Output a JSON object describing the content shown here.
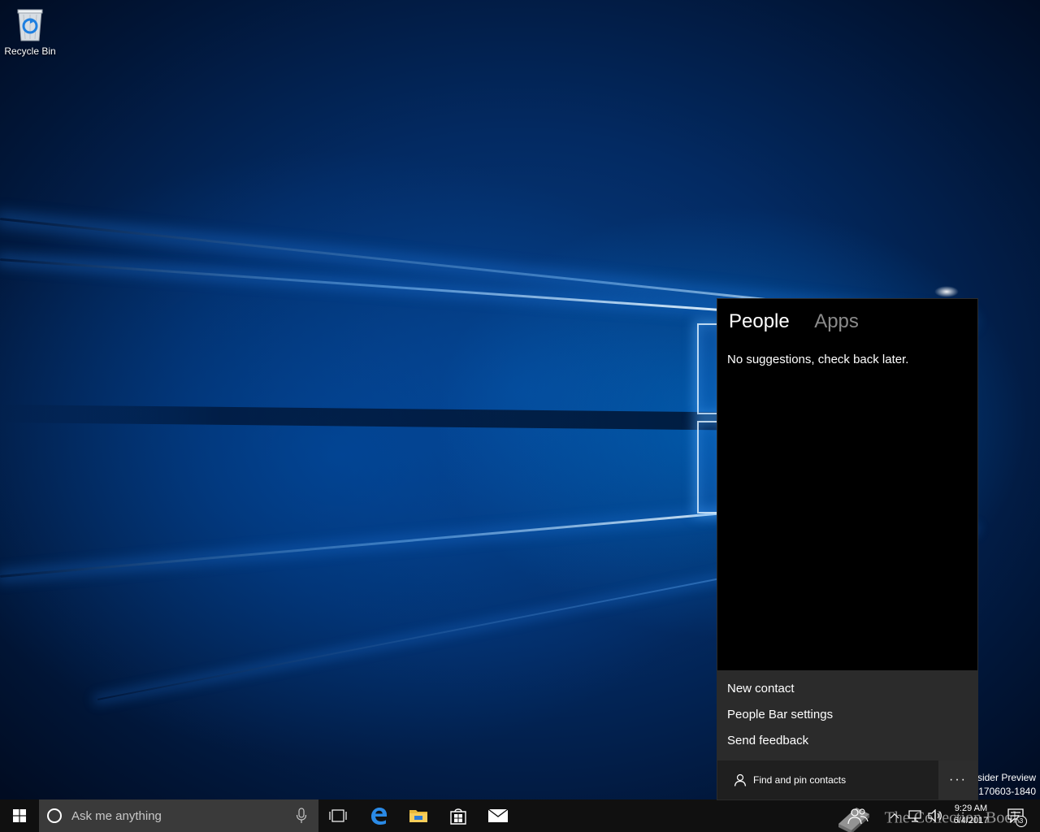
{
  "desktop": {
    "icons": [
      {
        "label": "Recycle Bin",
        "icon": "recycle-bin-icon"
      }
    ],
    "watermark": {
      "line1": "nsider Preview",
      "line2": "e.170603-1840"
    }
  },
  "people_flyout": {
    "tabs": [
      {
        "label": "People",
        "active": true
      },
      {
        "label": "Apps",
        "active": false
      }
    ],
    "empty_message": "No suggestions, check back later.",
    "menu": [
      {
        "label": "New contact"
      },
      {
        "label": "People Bar settings"
      },
      {
        "label": "Send feedback"
      }
    ],
    "find_contacts": {
      "label": "Find and pin contacts",
      "icon": "person-icon"
    },
    "more_button": {
      "label": "···",
      "icon": "more-icon"
    }
  },
  "taskbar": {
    "search_placeholder": "Ask me anything",
    "pinned": [
      {
        "icon": "task-view-icon"
      },
      {
        "icon": "edge-icon"
      },
      {
        "icon": "file-explorer-icon"
      },
      {
        "icon": "store-icon"
      },
      {
        "icon": "mail-icon"
      }
    ],
    "tray": {
      "time": "9:29 AM",
      "date": "6/4/2017",
      "notification_count": "3"
    },
    "overlay_text": "The Collection Book"
  },
  "colors": {
    "flyout_bg": "#000000",
    "flyout_menu_bg": "#2b2b2b",
    "taskbar_bg": "#101010",
    "search_bg": "#3a3a3a",
    "accent": "#0078d7"
  }
}
